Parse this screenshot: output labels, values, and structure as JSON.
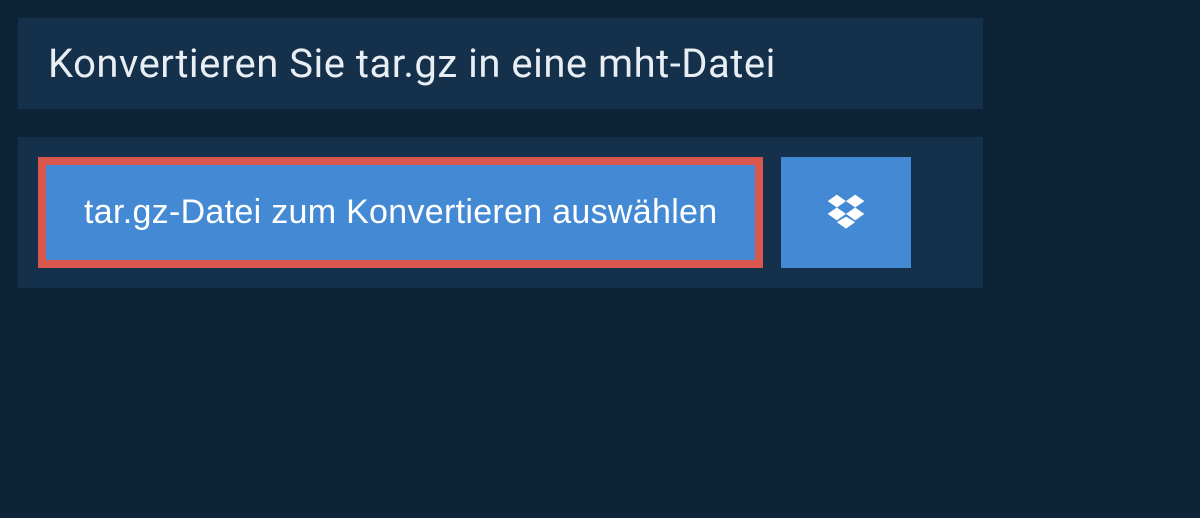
{
  "header": {
    "title": "Konvertieren Sie tar.gz in eine mht-Datei"
  },
  "upload": {
    "select_file_label": "tar.gz-Datei zum Konvertieren auswählen"
  },
  "colors": {
    "background": "#0d2438",
    "panel": "#14304a",
    "button": "#4489d4",
    "highlight_border": "#d9574d"
  }
}
